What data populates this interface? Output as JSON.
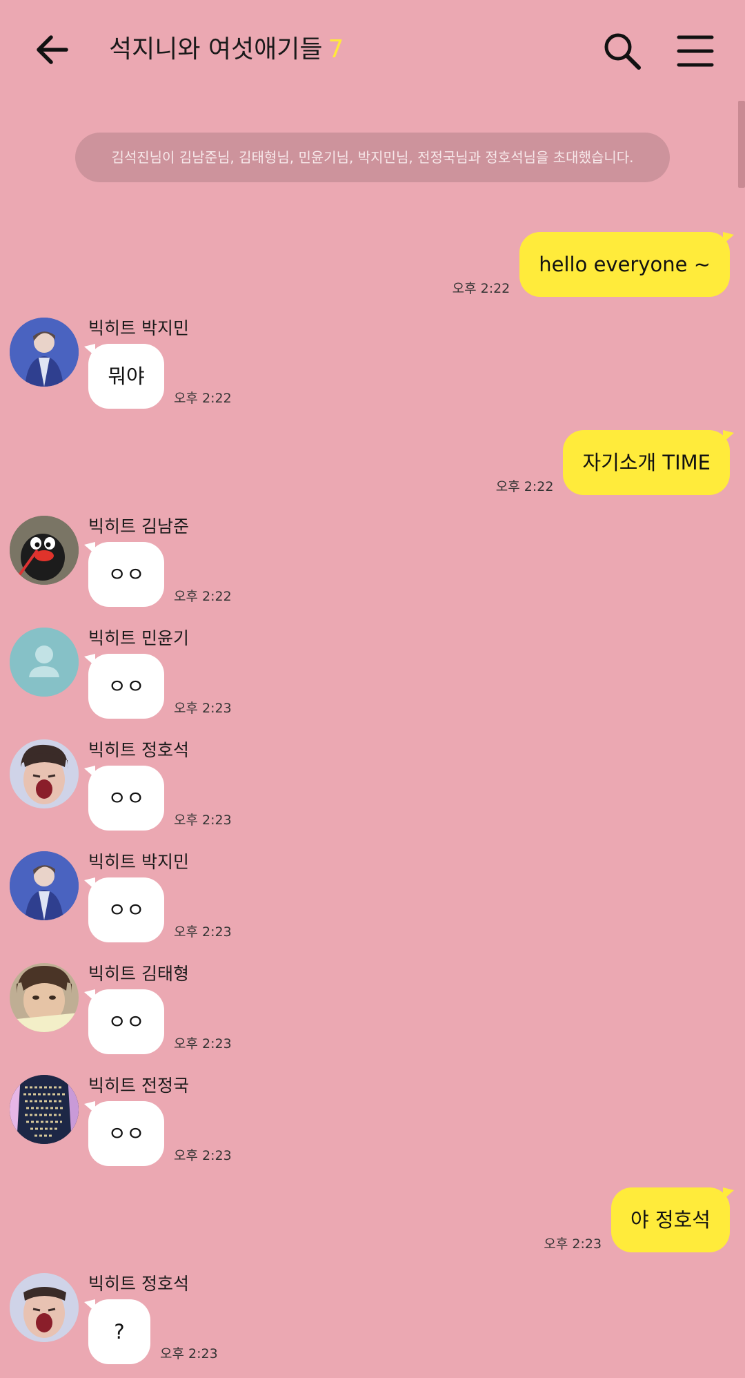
{
  "header": {
    "title": "석지니와 여섯애기들",
    "count": "7"
  },
  "notice": "김석진님이 김남준님, 김태형님, 민윤기님, 박지민님, 전정국님과 정호석님을 초대했습니다.",
  "messages": [
    {
      "text": "hello everyone ~",
      "time": "오후 2:22"
    },
    {
      "sender": "빅히트 박지민",
      "text": "뭐야",
      "time": "오후 2:22"
    },
    {
      "text": "자기소개 TIME",
      "time": "오후 2:22"
    },
    {
      "sender": "빅히트 김남준",
      "text": "ㅇㅇ",
      "time": "오후 2:22"
    },
    {
      "sender": "빅히트 민윤기",
      "text": "ㅇㅇ",
      "time": "오후 2:23"
    },
    {
      "sender": "빅히트 정호석",
      "text": "ㅇㅇ",
      "time": "오후 2:23"
    },
    {
      "sender": "빅히트 박지민",
      "text": "ㅇㅇ",
      "time": "오후 2:23"
    },
    {
      "sender": "빅히트 김태형",
      "text": "ㅇㅇ",
      "time": "오후 2:23"
    },
    {
      "sender": "빅히트 전정국",
      "text": "ㅇㅇ",
      "time": "오후 2:23"
    },
    {
      "text": "야 정호석",
      "time": "오후 2:23"
    },
    {
      "sender": "빅히트 정호석",
      "text": "?",
      "time": "오후 2:23"
    }
  ],
  "colors": {
    "background": "#eba8b2",
    "my_bubble": "#ffeb3b",
    "their_bubble": "#ffffff",
    "count_accent": "#ffe93b"
  }
}
